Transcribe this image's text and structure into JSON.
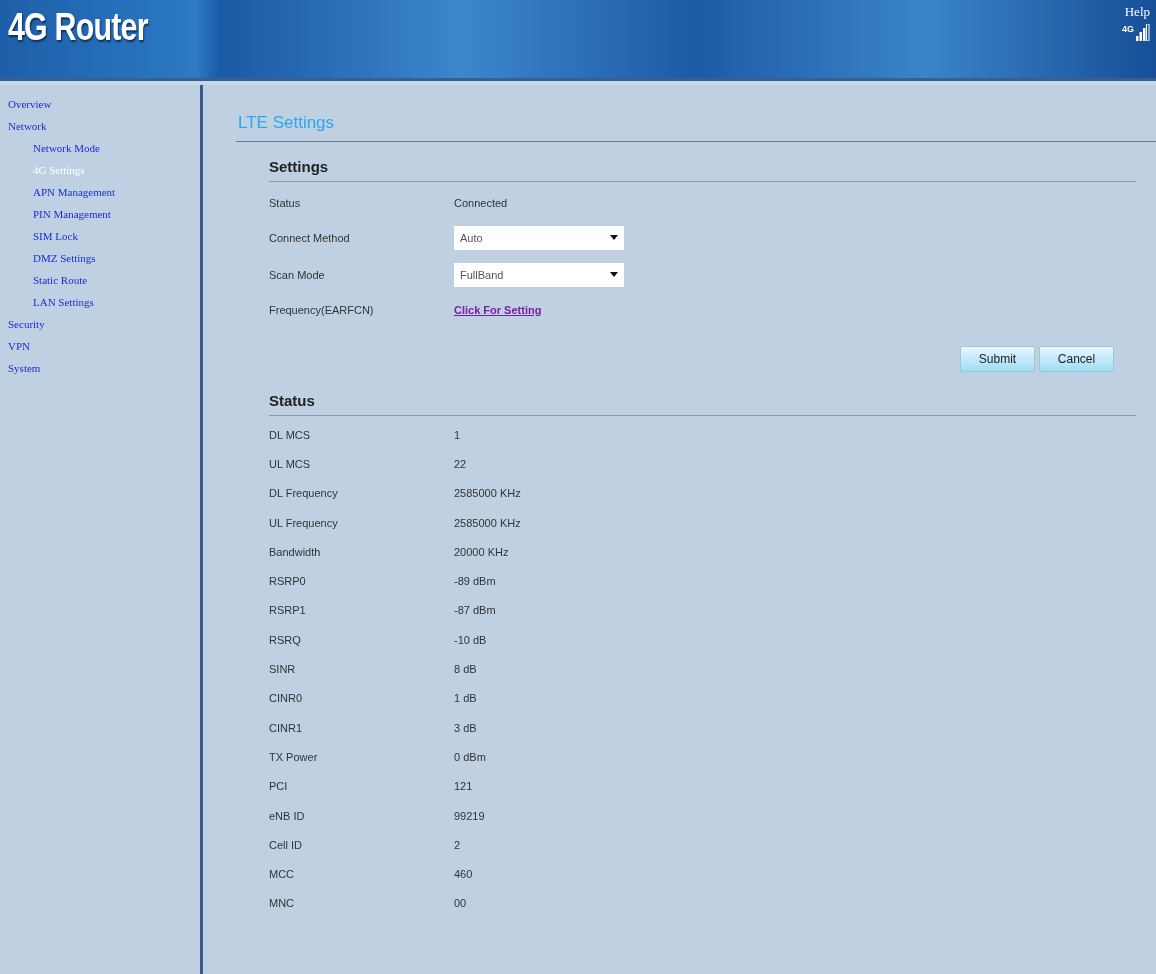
{
  "header": {
    "logo": "4G Router",
    "help": "Help",
    "network_badge": "4G"
  },
  "sidebar": {
    "items": [
      {
        "label": "Overview",
        "selected": false
      },
      {
        "label": "Network",
        "selected": false,
        "children": [
          {
            "label": "Network Mode",
            "selected": false
          },
          {
            "label": "4G Settings",
            "selected": true
          },
          {
            "label": "APN Management",
            "selected": false
          },
          {
            "label": "PIN Management",
            "selected": false
          },
          {
            "label": "SIM Lock",
            "selected": false
          },
          {
            "label": "DMZ Settings",
            "selected": false
          },
          {
            "label": "Static Route",
            "selected": false
          },
          {
            "label": "LAN Settings",
            "selected": false
          }
        ]
      },
      {
        "label": "Security",
        "selected": false
      },
      {
        "label": "VPN",
        "selected": false
      },
      {
        "label": "System",
        "selected": false
      }
    ]
  },
  "page_title": "LTE Settings",
  "settings": {
    "title": "Settings",
    "rows": [
      {
        "kind": "text",
        "label": "Status",
        "value": "Connected"
      },
      {
        "kind": "select",
        "label": "Connect Method",
        "value": "Auto"
      },
      {
        "kind": "select",
        "label": "Scan Mode",
        "value": "FullBand"
      },
      {
        "kind": "link",
        "label": "Frequency(EARFCN)",
        "value": "Click For Setting"
      }
    ],
    "buttons": [
      "Submit",
      "Cancel"
    ]
  },
  "status": {
    "title": "Status",
    "rows": [
      {
        "label": "DL MCS",
        "value": "1"
      },
      {
        "label": "UL MCS",
        "value": "22"
      },
      {
        "label": "DL Frequency",
        "value": "2585000 KHz"
      },
      {
        "label": "UL Frequency",
        "value": "2585000 KHz"
      },
      {
        "label": "Bandwidth",
        "value": "20000 KHz"
      },
      {
        "label": "RSRP0",
        "value": "-89 dBm"
      },
      {
        "label": "RSRP1",
        "value": "-87 dBm"
      },
      {
        "label": "RSRQ",
        "value": "-10 dB"
      },
      {
        "label": "SINR",
        "value": "8 dB"
      },
      {
        "label": "CINR0",
        "value": "1 dB"
      },
      {
        "label": "CINR1",
        "value": "3 dB"
      },
      {
        "label": "TX Power",
        "value": "0 dBm"
      },
      {
        "label": "PCI",
        "value": "121"
      },
      {
        "label": "eNB ID",
        "value": "99219"
      },
      {
        "label": "Cell ID",
        "value": "2"
      },
      {
        "label": "MCC",
        "value": "460"
      },
      {
        "label": "MNC",
        "value": "00"
      }
    ]
  }
}
